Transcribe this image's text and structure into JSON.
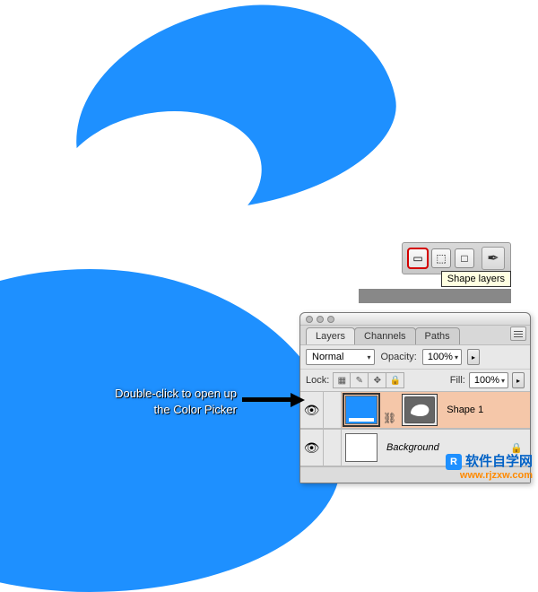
{
  "shapes": {
    "color": "#1e90ff"
  },
  "option_bar": {
    "tooltip": "Shape layers",
    "buttons": [
      {
        "name": "shape-layers-mode",
        "glyph": "▭",
        "selected": true
      },
      {
        "name": "paths-mode",
        "glyph": "⬚",
        "selected": false
      },
      {
        "name": "fill-pixels-mode",
        "glyph": "□",
        "selected": false
      }
    ],
    "pen_glyph": "✒"
  },
  "panel": {
    "tabs": {
      "layers": "Layers",
      "channels": "Channels",
      "paths": "Paths"
    },
    "blend_mode": "Normal",
    "opacity_label": "Opacity:",
    "opacity_value": "100%",
    "lock_label": "Lock:",
    "fill_label": "Fill:",
    "fill_value": "100%",
    "layers": [
      {
        "name": "Shape 1",
        "visible": true,
        "selected": true,
        "kind": "shape"
      },
      {
        "name": "Background",
        "visible": true,
        "selected": false,
        "kind": "bg",
        "locked": true
      }
    ]
  },
  "annotation": {
    "line1": "Double-click to open up",
    "line2": "the Color Picker"
  },
  "watermark": {
    "logo": "R",
    "title": "软件自学网",
    "url": "www.rjzxw.com"
  }
}
